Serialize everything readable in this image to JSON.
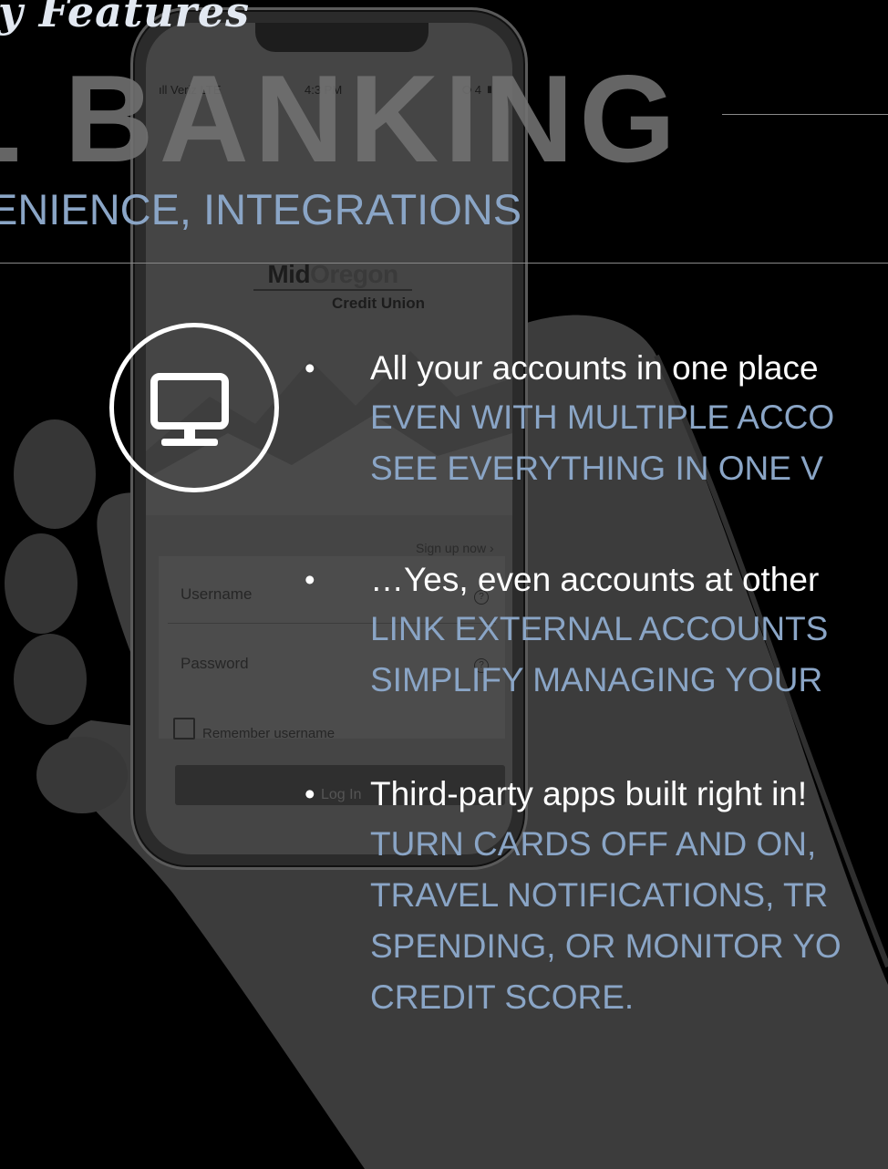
{
  "slide": {
    "top_subtitle": "y Features",
    "heading": "L BANKING",
    "tagline": "ENIENCE, INTEGRATIONS"
  },
  "phone": {
    "status": {
      "carrier": "ıll Veriz   LTE",
      "time": "4:3  PM",
      "battery": "⭘ 4  ▮"
    },
    "logo": {
      "mid": "Mid",
      "oregon": "Oregon",
      "sub": "Credit Union"
    },
    "signup_label": "Sign up now  ›",
    "username_label": "Username",
    "password_label": "Password",
    "help_glyph": "?",
    "remember_label": "Remember username",
    "login_label": "Log In"
  },
  "bullets": [
    {
      "title": "All your accounts in one place",
      "details": [
        "EVEN WITH MULTIPLE ACCO",
        "SEE EVERYTHING IN ONE V"
      ]
    },
    {
      "title": "…Yes, even accounts at other",
      "details": [
        "LINK EXTERNAL ACCOUNTS",
        "SIMPLIFY MANAGING YOUR"
      ]
    },
    {
      "title": "Third-party apps built right in!",
      "details": [
        "TURN CARDS OFF AND ON, ",
        "TRAVEL NOTIFICATIONS, TR",
        "SPENDING, OR MONITOR YO",
        "CREDIT SCORE."
      ]
    }
  ],
  "bullet_glyph": "•",
  "icons": {
    "feature": "monitor-icon"
  },
  "colors": {
    "accent": "#8aa5c6",
    "background": "#000000",
    "heading_gray": "#707070"
  }
}
